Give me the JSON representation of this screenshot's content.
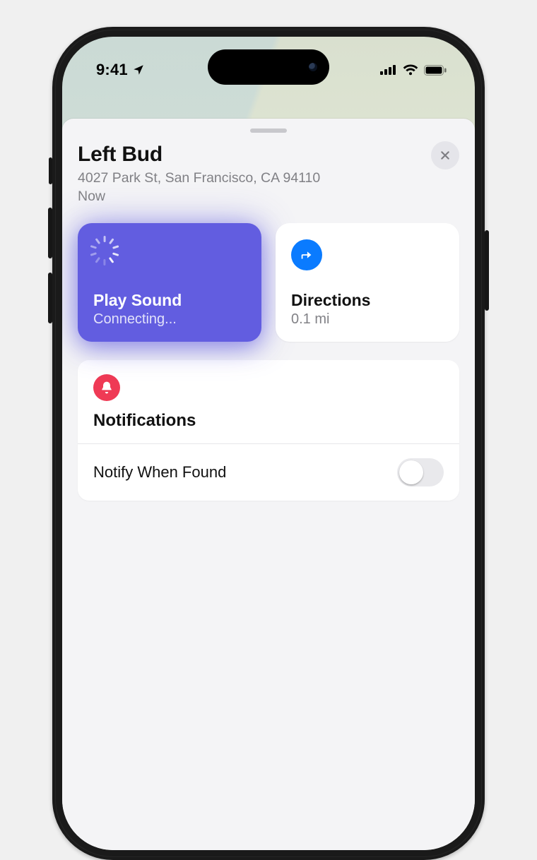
{
  "status": {
    "time": "9:41",
    "location_icon": "location-arrow",
    "cell_bars": 4,
    "wifi": true,
    "battery_pct": 100
  },
  "sheet": {
    "title": "Left Bud",
    "address": "4027 Park St, San Francisco, CA  94110",
    "timestamp": "Now"
  },
  "actions": {
    "play_sound": {
      "label": "Play Sound",
      "status": "Connecting..."
    },
    "directions": {
      "label": "Directions",
      "distance": "0.1 mi"
    }
  },
  "notifications": {
    "section_title": "Notifications",
    "notify_when_found": {
      "label": "Notify When Found",
      "enabled": false
    }
  },
  "colors": {
    "accent_purple": "#625de0",
    "accent_blue": "#0a7bff",
    "accent_red": "#ef3a55"
  }
}
